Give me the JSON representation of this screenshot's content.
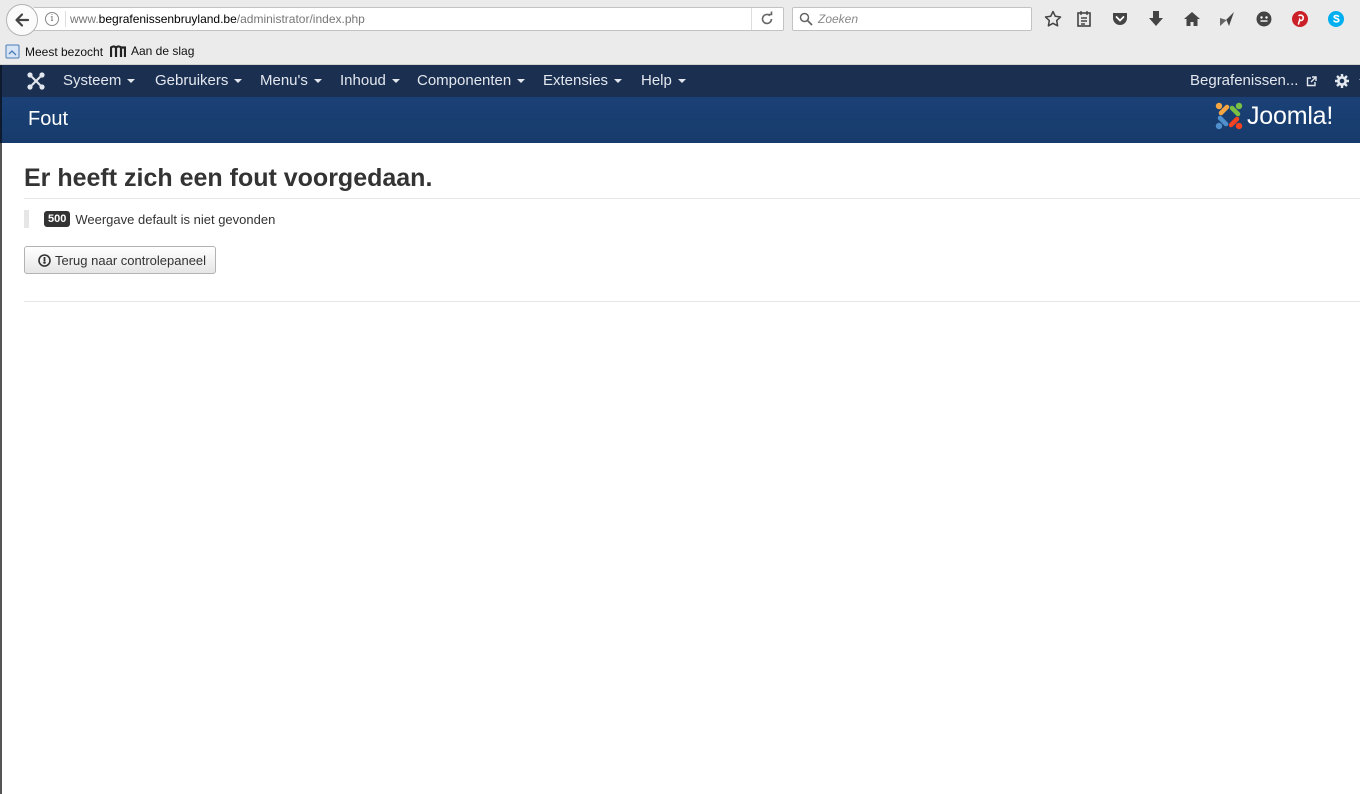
{
  "browser": {
    "url_prefix": "www.",
    "url_domain": "begrafenissenbruyland.be",
    "url_path": "/administrator/index.php",
    "search_placeholder": "Zoeken",
    "bookmarks": [
      {
        "label": "Meest bezocht",
        "icon": "bookmark-folder-icon"
      },
      {
        "label": "Aan de slag",
        "icon": "m-logo-icon"
      }
    ],
    "toolbar_icons": [
      "star-icon",
      "reader-icon",
      "pocket-icon",
      "download-icon",
      "home-icon",
      "send-icon",
      "emoji-icon",
      "pinterest-icon",
      "skype-icon"
    ]
  },
  "nav": {
    "items": [
      {
        "label": "Systeem"
      },
      {
        "label": "Gebruikers"
      },
      {
        "label": "Menu's"
      },
      {
        "label": "Inhoud"
      },
      {
        "label": "Componenten"
      },
      {
        "label": "Extensies"
      },
      {
        "label": "Help"
      }
    ],
    "site_link": "Begrafenissen...",
    "settings_icon": "gear-icon"
  },
  "header": {
    "title": "Fout",
    "logo_text": "Joomla!"
  },
  "error": {
    "heading": "Er heeft zich een fout voorgedaan.",
    "code": "500",
    "message": "Weergave default is niet gevonden",
    "back_button": "Terug naar controlepaneel"
  },
  "colors": {
    "nav_bg": "#1b2f51",
    "header_bg": "#1a4177",
    "badge_bg": "#333333"
  }
}
